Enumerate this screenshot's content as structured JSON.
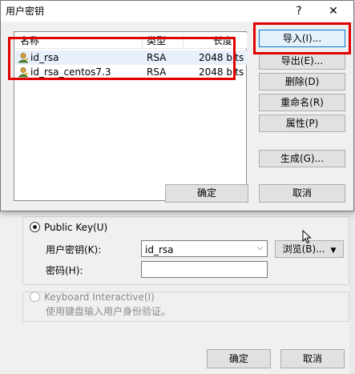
{
  "bg": {
    "public_key_label": "Public Key(U)",
    "user_key_label": "用户密钥(K):",
    "user_key_value": "id_rsa",
    "browse_label": "浏览(B)...",
    "password_label": "密码(H):",
    "password_value": "",
    "keyboard_label": "Keyboard Interactive(I)",
    "keyboard_desc": "使用键盘输入用户身份验证。",
    "ok_label": "确定",
    "cancel_label": "取消"
  },
  "dialog": {
    "title": "用户密钥",
    "help_glyph": "?",
    "close_glyph": "✕",
    "columns": [
      "名称",
      "类型",
      "长度"
    ],
    "rows": [
      {
        "name": "id_rsa",
        "type": "RSA",
        "length": "2048 bits",
        "selected": true
      },
      {
        "name": "id_rsa_centos7.3",
        "type": "RSA",
        "length": "2048 bits",
        "selected": false
      }
    ],
    "buttons": {
      "import": "导入(I)...",
      "export": "导出(E)...",
      "delete": "删除(D)",
      "rename": "重命名(R)",
      "properties": "属性(P)",
      "generate": "生成(G)...",
      "ok": "确定",
      "cancel": "取消"
    },
    "accent_red": "#e00000",
    "selection_color": "#e7f0fb"
  }
}
